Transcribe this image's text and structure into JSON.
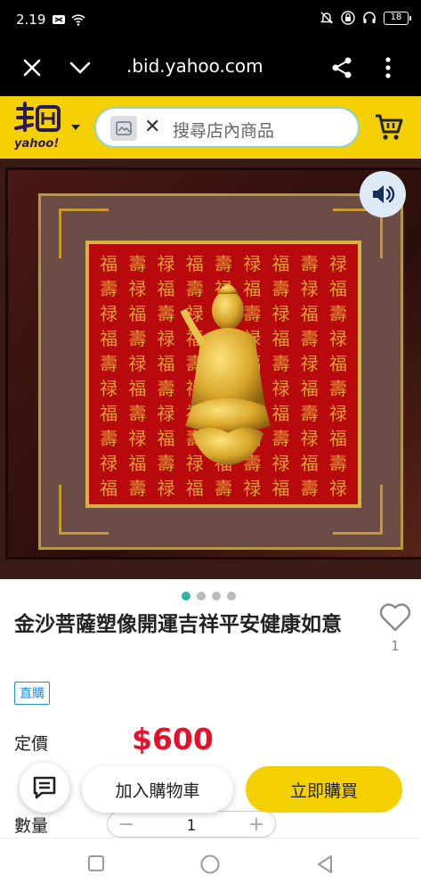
{
  "status_bar": {
    "time": "2.19",
    "battery": "18"
  },
  "browser": {
    "url": ".bid.yahoo.com",
    "close_icon": "close-icon",
    "dropdown_icon": "chevron-down-icon",
    "share_icon": "share-icon",
    "menu_icon": "more-vert-icon"
  },
  "header": {
    "logo_word": "yahoo!",
    "search_placeholder": "搜尋店內商品",
    "clear_symbol": "✕",
    "accent_color": "#f5d000"
  },
  "product": {
    "title": "金沙菩薩塑像開運吉祥平安健康如意",
    "like_count": "1",
    "badge": "直購",
    "price_label": "定價",
    "price": "$600",
    "quantity_label": "數量",
    "quantity": "1",
    "minus": "−",
    "plus": "+",
    "image_count": 4,
    "active_image_index": 0
  },
  "actions": {
    "add_to_cart": "加入購物車",
    "buy_now": "立即購買"
  },
  "colors": {
    "price": "#e5112a",
    "badge": "#1e8fe0",
    "dot_active": "#2cb3a7"
  }
}
